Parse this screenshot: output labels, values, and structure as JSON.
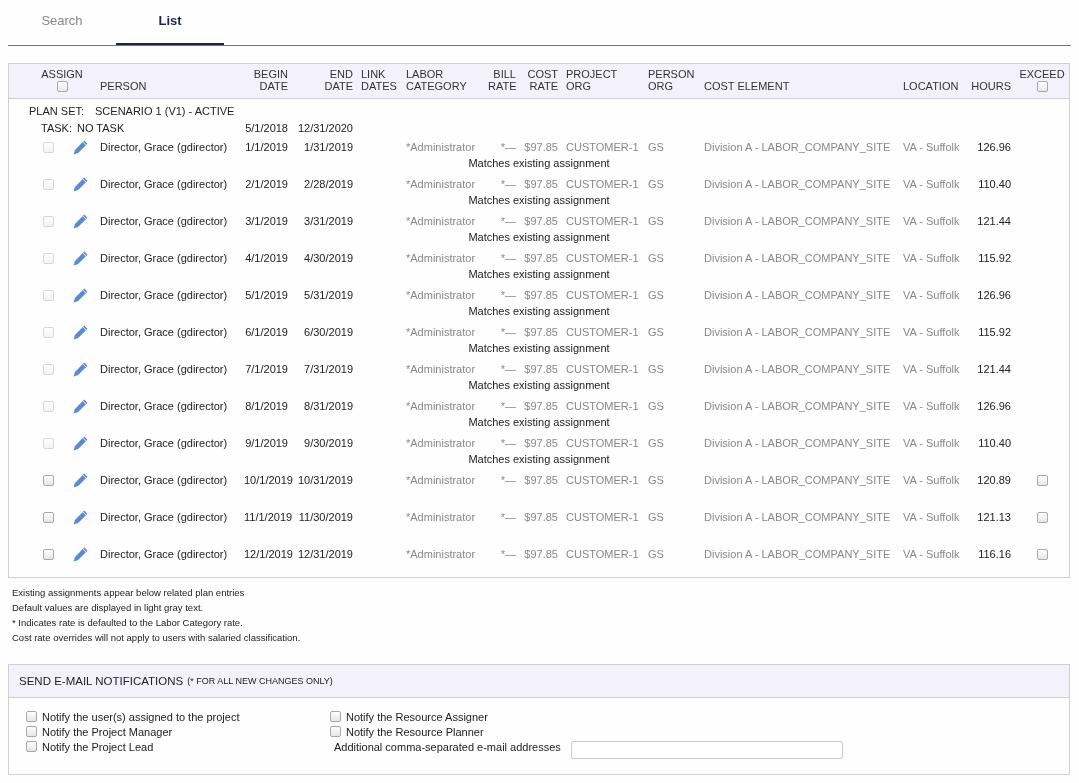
{
  "tabs": [
    {
      "label": "Search",
      "selected": false
    },
    {
      "label": "List",
      "selected": true
    }
  ],
  "table": {
    "columns": [
      {
        "label": "ASSIGN",
        "checkbox": {
          "checked": false
        }
      },
      {
        "label": "PERSON"
      },
      {
        "label": "BEGIN\nDATE"
      },
      {
        "label": "END\nDATE"
      },
      {
        "label": "LINK\nDATES"
      },
      {
        "label": "LABOR\nCATEGORY"
      },
      {
        "label": "BILL\nRATE"
      },
      {
        "label": "COST\nRATE"
      },
      {
        "label": "PROJECT\nORG"
      },
      {
        "label": "PERSON\nORG"
      },
      {
        "label": "COST ELEMENT"
      },
      {
        "label": "LOCATION"
      },
      {
        "label": "HOURS"
      },
      {
        "label": "EXCEED",
        "checkbox": {
          "checked": false
        }
      }
    ],
    "plan_set": {
      "label": "PLAN SET:",
      "value": "SCENARIO 1 (V1) - ACTIVE"
    },
    "task": {
      "label": "TASK:",
      "value": "NO TASK",
      "begin_date": "5/1/2018",
      "end_date": "12/31/2020"
    },
    "rows": [
      {
        "assign": {
          "checked": false,
          "disabled": true
        },
        "person": "Director, Grace (gdirector)",
        "begin_date": "1/1/2019",
        "end_date": "1/31/2019",
        "labor_category": "*Administrator",
        "bill_rate": "*—",
        "cost_rate": "$97.85",
        "project_org": "CUSTOMER-1",
        "person_org": "GS",
        "cost_element": "Division A - LABOR_COMPANY_SITE",
        "location": "VA - Suffolk",
        "hours": "126.96",
        "note": "Matches existing assignment"
      },
      {
        "assign": {
          "checked": false,
          "disabled": true
        },
        "person": "Director, Grace (gdirector)",
        "begin_date": "2/1/2019",
        "end_date": "2/28/2019",
        "labor_category": "*Administrator",
        "bill_rate": "*—",
        "cost_rate": "$97.85",
        "project_org": "CUSTOMER-1",
        "person_org": "GS",
        "cost_element": "Division A - LABOR_COMPANY_SITE",
        "location": "VA - Suffolk",
        "hours": "110.40",
        "note": "Matches existing assignment"
      },
      {
        "assign": {
          "checked": false,
          "disabled": true
        },
        "person": "Director, Grace (gdirector)",
        "begin_date": "3/1/2019",
        "end_date": "3/31/2019",
        "labor_category": "*Administrator",
        "bill_rate": "*—",
        "cost_rate": "$97.85",
        "project_org": "CUSTOMER-1",
        "person_org": "GS",
        "cost_element": "Division A - LABOR_COMPANY_SITE",
        "location": "VA - Suffolk",
        "hours": "121.44",
        "note": "Matches existing assignment"
      },
      {
        "assign": {
          "checked": false,
          "disabled": true
        },
        "person": "Director, Grace (gdirector)",
        "begin_date": "4/1/2019",
        "end_date": "4/30/2019",
        "labor_category": "*Administrator",
        "bill_rate": "*—",
        "cost_rate": "$97.85",
        "project_org": "CUSTOMER-1",
        "person_org": "GS",
        "cost_element": "Division A - LABOR_COMPANY_SITE",
        "location": "VA - Suffolk",
        "hours": "115.92",
        "note": "Matches existing assignment"
      },
      {
        "assign": {
          "checked": false,
          "disabled": true
        },
        "person": "Director, Grace (gdirector)",
        "begin_date": "5/1/2019",
        "end_date": "5/31/2019",
        "labor_category": "*Administrator",
        "bill_rate": "*—",
        "cost_rate": "$97.85",
        "project_org": "CUSTOMER-1",
        "person_org": "GS",
        "cost_element": "Division A - LABOR_COMPANY_SITE",
        "location": "VA - Suffolk",
        "hours": "126.96",
        "note": "Matches existing assignment"
      },
      {
        "assign": {
          "checked": false,
          "disabled": true
        },
        "person": "Director, Grace (gdirector)",
        "begin_date": "6/1/2019",
        "end_date": "6/30/2019",
        "labor_category": "*Administrator",
        "bill_rate": "*—",
        "cost_rate": "$97.85",
        "project_org": "CUSTOMER-1",
        "person_org": "GS",
        "cost_element": "Division A - LABOR_COMPANY_SITE",
        "location": "VA - Suffolk",
        "hours": "115.92",
        "note": "Matches existing assignment"
      },
      {
        "assign": {
          "checked": false,
          "disabled": true
        },
        "person": "Director, Grace (gdirector)",
        "begin_date": "7/1/2019",
        "end_date": "7/31/2019",
        "labor_category": "*Administrator",
        "bill_rate": "*—",
        "cost_rate": "$97.85",
        "project_org": "CUSTOMER-1",
        "person_org": "GS",
        "cost_element": "Division A - LABOR_COMPANY_SITE",
        "location": "VA - Suffolk",
        "hours": "121.44",
        "note": "Matches existing assignment"
      },
      {
        "assign": {
          "checked": false,
          "disabled": true
        },
        "person": "Director, Grace (gdirector)",
        "begin_date": "8/1/2019",
        "end_date": "8/31/2019",
        "labor_category": "*Administrator",
        "bill_rate": "*—",
        "cost_rate": "$97.85",
        "project_org": "CUSTOMER-1",
        "person_org": "GS",
        "cost_element": "Division A - LABOR_COMPANY_SITE",
        "location": "VA - Suffolk",
        "hours": "126.96",
        "note": "Matches existing assignment"
      },
      {
        "assign": {
          "checked": false,
          "disabled": true
        },
        "person": "Director, Grace (gdirector)",
        "begin_date": "9/1/2019",
        "end_date": "9/30/2019",
        "labor_category": "*Administrator",
        "bill_rate": "*—",
        "cost_rate": "$97.85",
        "project_org": "CUSTOMER-1",
        "person_org": "GS",
        "cost_element": "Division A - LABOR_COMPANY_SITE",
        "location": "VA - Suffolk",
        "hours": "110.40",
        "note": "Matches existing assignment"
      },
      {
        "assign": {
          "checked": false,
          "disabled": false
        },
        "person": "Director, Grace (gdirector)",
        "begin_date": "10/1/2019",
        "end_date": "10/31/2019",
        "labor_category": "*Administrator",
        "bill_rate": "*—",
        "cost_rate": "$97.85",
        "project_org": "CUSTOMER-1",
        "person_org": "GS",
        "cost_element": "Division A - LABOR_COMPANY_SITE",
        "location": "VA - Suffolk",
        "hours": "120.89",
        "exceed": {
          "checked": false
        }
      },
      {
        "assign": {
          "checked": false,
          "disabled": false
        },
        "person": "Director, Grace (gdirector)",
        "begin_date": "11/1/2019",
        "end_date": "11/30/2019",
        "labor_category": "*Administrator",
        "bill_rate": "*—",
        "cost_rate": "$97.85",
        "project_org": "CUSTOMER-1",
        "person_org": "GS",
        "cost_element": "Division A - LABOR_COMPANY_SITE",
        "location": "VA - Suffolk",
        "hours": "121.13",
        "exceed": {
          "checked": false
        }
      },
      {
        "assign": {
          "checked": false,
          "disabled": false
        },
        "person": "Director, Grace (gdirector)",
        "begin_date": "12/1/2019",
        "end_date": "12/31/2019",
        "labor_category": "*Administrator",
        "bill_rate": "*—",
        "cost_rate": "$97.85",
        "project_org": "CUSTOMER-1",
        "person_org": "GS",
        "cost_element": "Division A - LABOR_COMPANY_SITE",
        "location": "VA - Suffolk",
        "hours": "116.16",
        "exceed": {
          "checked": false
        }
      }
    ]
  },
  "footnotes": [
    "Existing assignments appear below related plan entries",
    "Default values are displayed in light gray text.",
    "* Indicates rate is defaulted to the Labor Category rate.",
    "Cost rate overrides will not apply to users with salaried classification."
  ],
  "notifications": {
    "title": "SEND E-MAIL NOTIFICATIONS",
    "subtitle": "(* FOR ALL NEW CHANGES ONLY)",
    "left_options": [
      {
        "label": "Notify the user(s) assigned to the project",
        "checked": false
      },
      {
        "label": "Notify the Project Manager",
        "checked": false
      },
      {
        "label": "Notify the Project Lead",
        "checked": false
      }
    ],
    "right_options": [
      {
        "label": "Notify the Resource Assigner",
        "checked": false
      },
      {
        "label": "Notify the Resource Planner",
        "checked": false
      }
    ],
    "email_field": {
      "label": "Additional comma-separated e-mail addresses"
    }
  }
}
